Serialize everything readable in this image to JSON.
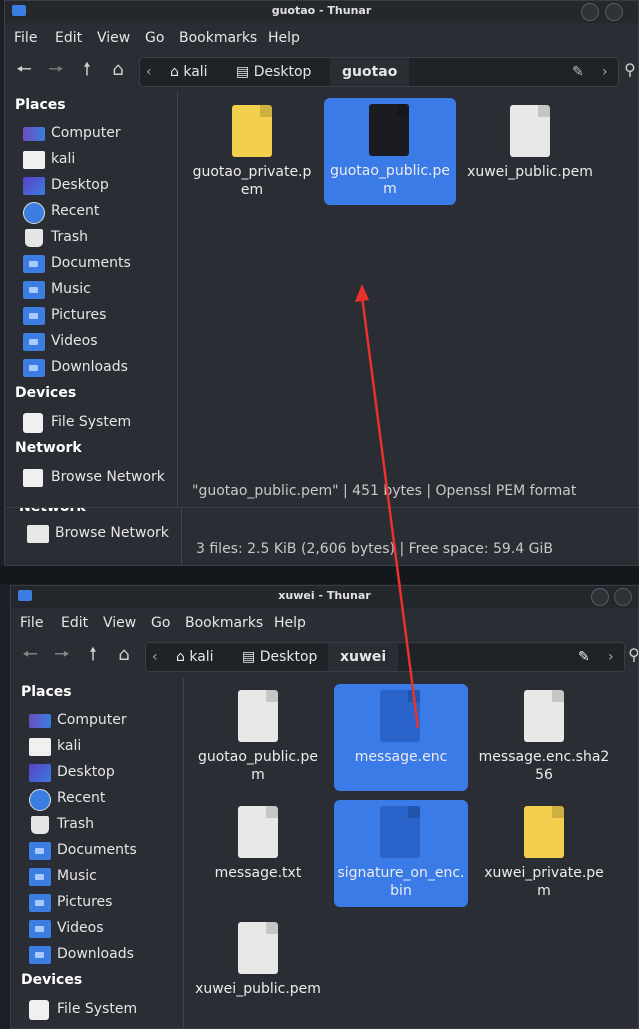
{
  "top_window": {
    "title": "guotao - Thunar",
    "menu": [
      "File",
      "Edit",
      "View",
      "Go",
      "Bookmarks",
      "Help"
    ],
    "path": [
      "kali",
      "Desktop",
      "guotao"
    ],
    "sidebar": {
      "places_label": "Places",
      "places": [
        "Computer",
        "kali",
        "Desktop",
        "Recent",
        "Trash",
        "Documents",
        "Music",
        "Pictures",
        "Videos",
        "Downloads"
      ],
      "devices_label": "Devices",
      "devices": [
        "File System"
      ],
      "network_label": "Network",
      "network": [
        "Browse Network"
      ]
    },
    "files": [
      {
        "name": "guotao_private.pem",
        "icon": "certificate-icon"
      },
      {
        "name": "guotao_public.pem",
        "icon": "key-icon"
      },
      {
        "name": "xuwei_public.pem",
        "icon": "key-icon"
      }
    ],
    "status": "\"guotao_public.pem\" | 451 bytes | Openssl PEM format"
  },
  "behind_window": {
    "network_label": "Network",
    "network_item": "Browse Network",
    "status": "3 files: 2.5 KiB (2,606 bytes) | Free space: 59.4 GiB"
  },
  "bottom_window": {
    "title": "xuwei - Thunar",
    "menu": [
      "File",
      "Edit",
      "View",
      "Go",
      "Bookmarks",
      "Help"
    ],
    "path": [
      "kali",
      "Desktop",
      "xuwei"
    ],
    "sidebar": {
      "places_label": "Places",
      "places": [
        "Computer",
        "kali",
        "Desktop",
        "Recent",
        "Trash",
        "Documents",
        "Music",
        "Pictures",
        "Videos",
        "Downloads"
      ],
      "devices_label": "Devices",
      "devices": [
        "File System"
      ]
    },
    "files": [
      {
        "name": "guotao_public.pem",
        "icon": "key-icon"
      },
      {
        "name": "message.enc",
        "icon": "binary-icon"
      },
      {
        "name": "message.enc.sha256",
        "icon": "text-icon"
      },
      {
        "name": "message.txt",
        "icon": "text-icon"
      },
      {
        "name": "signature_on_enc.bin",
        "icon": "binary-icon"
      },
      {
        "name": "xuwei_private.pem",
        "icon": "certificate-icon"
      },
      {
        "name": "xuwei_public.pem",
        "icon": "key-icon"
      }
    ]
  },
  "colors": {
    "selection": "#3a7be8",
    "folder": "#3b7de0",
    "arrow": "#e8322b"
  }
}
